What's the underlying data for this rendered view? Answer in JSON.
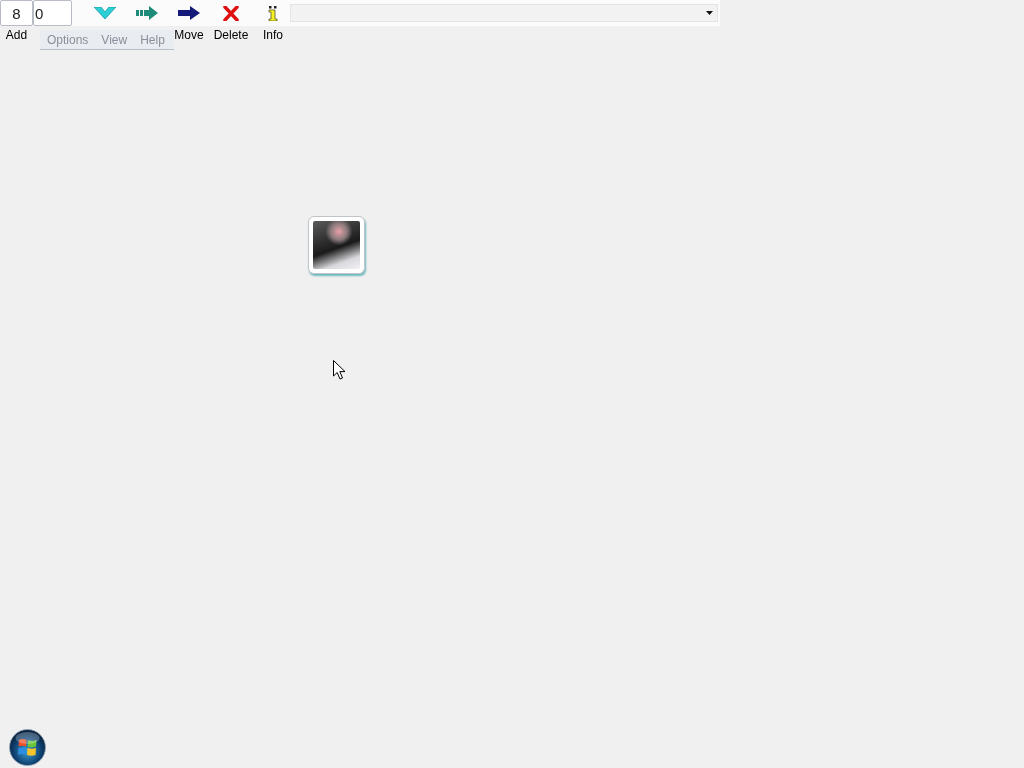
{
  "toolbar": {
    "fields": [
      {
        "value": "8"
      },
      {
        "value": "0"
      }
    ],
    "add_label": "Add",
    "buttons": [
      {
        "kind": "check"
      },
      {
        "kind": "forward"
      },
      {
        "kind": "move",
        "label": "Move"
      },
      {
        "kind": "delete",
        "label": "Delete"
      },
      {
        "kind": "info",
        "label": "Info"
      }
    ]
  },
  "menu": {
    "items": [
      {
        "label": "Options",
        "disabled": true
      },
      {
        "label": "View",
        "disabled": true
      },
      {
        "label": "Help",
        "disabled": true
      }
    ]
  }
}
